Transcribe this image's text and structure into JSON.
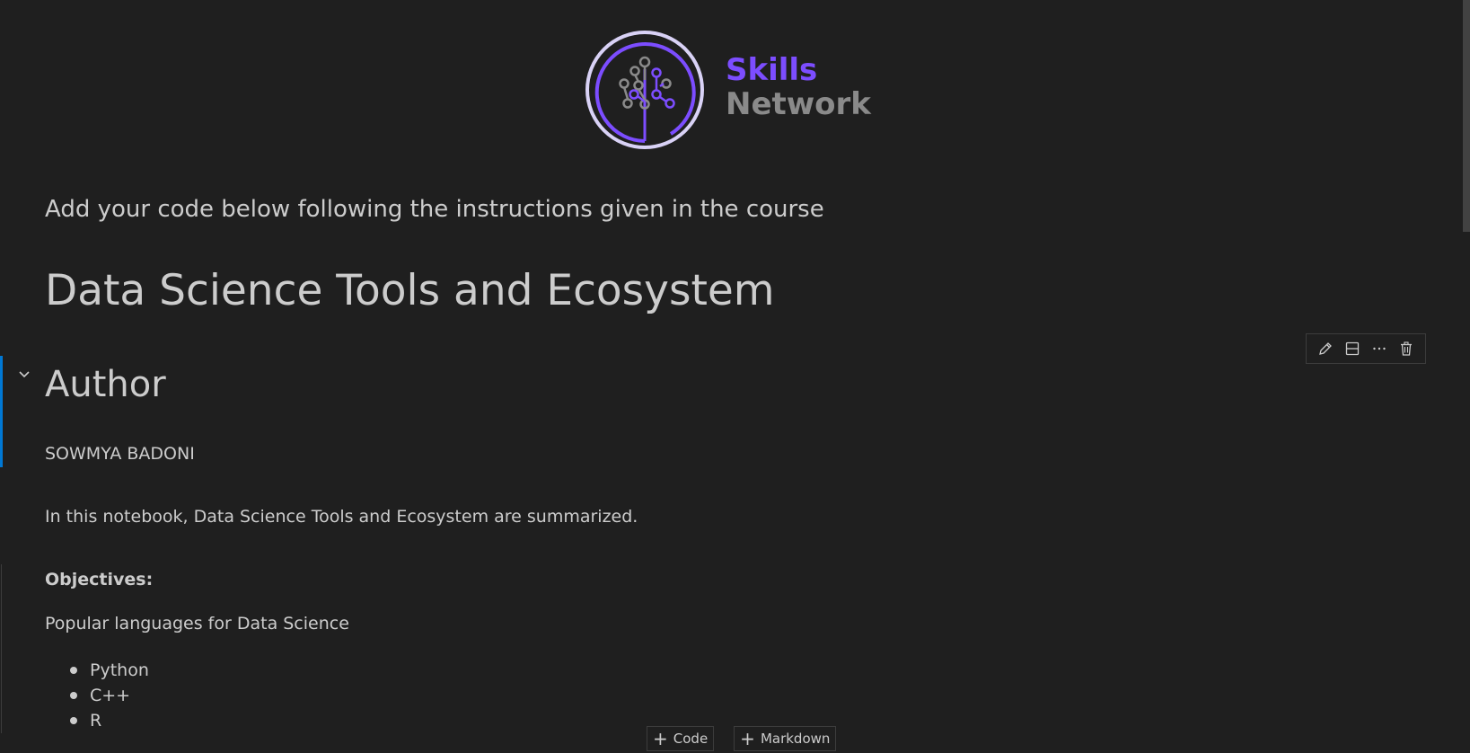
{
  "logo": {
    "line1": "Skills",
    "line2": "Network",
    "brand_color": "#7c4dff",
    "secondary_color": "#8a8a8a"
  },
  "notebook": {
    "intro": "Add your code below following the instructions given in the course",
    "title": "Data Science Tools and Ecosystem",
    "author_heading": "Author",
    "author_name": "SOWMYA BADONI",
    "summary": "In this notebook, Data Science Tools and Ecosystem are summarized.",
    "objectives_label": "Objectives:",
    "languages_intro": "Popular languages for Data Science",
    "languages": [
      "Python",
      "C++",
      "R"
    ]
  },
  "cell_toolbar": {
    "icons": [
      "edit-icon",
      "split-cell-icon",
      "more-icon",
      "delete-icon"
    ]
  },
  "add_cell": {
    "code_label": "Code",
    "markdown_label": "Markdown"
  },
  "colors": {
    "background": "#1f1f1f",
    "text": "#cccccc",
    "focus": "#0078d4"
  }
}
